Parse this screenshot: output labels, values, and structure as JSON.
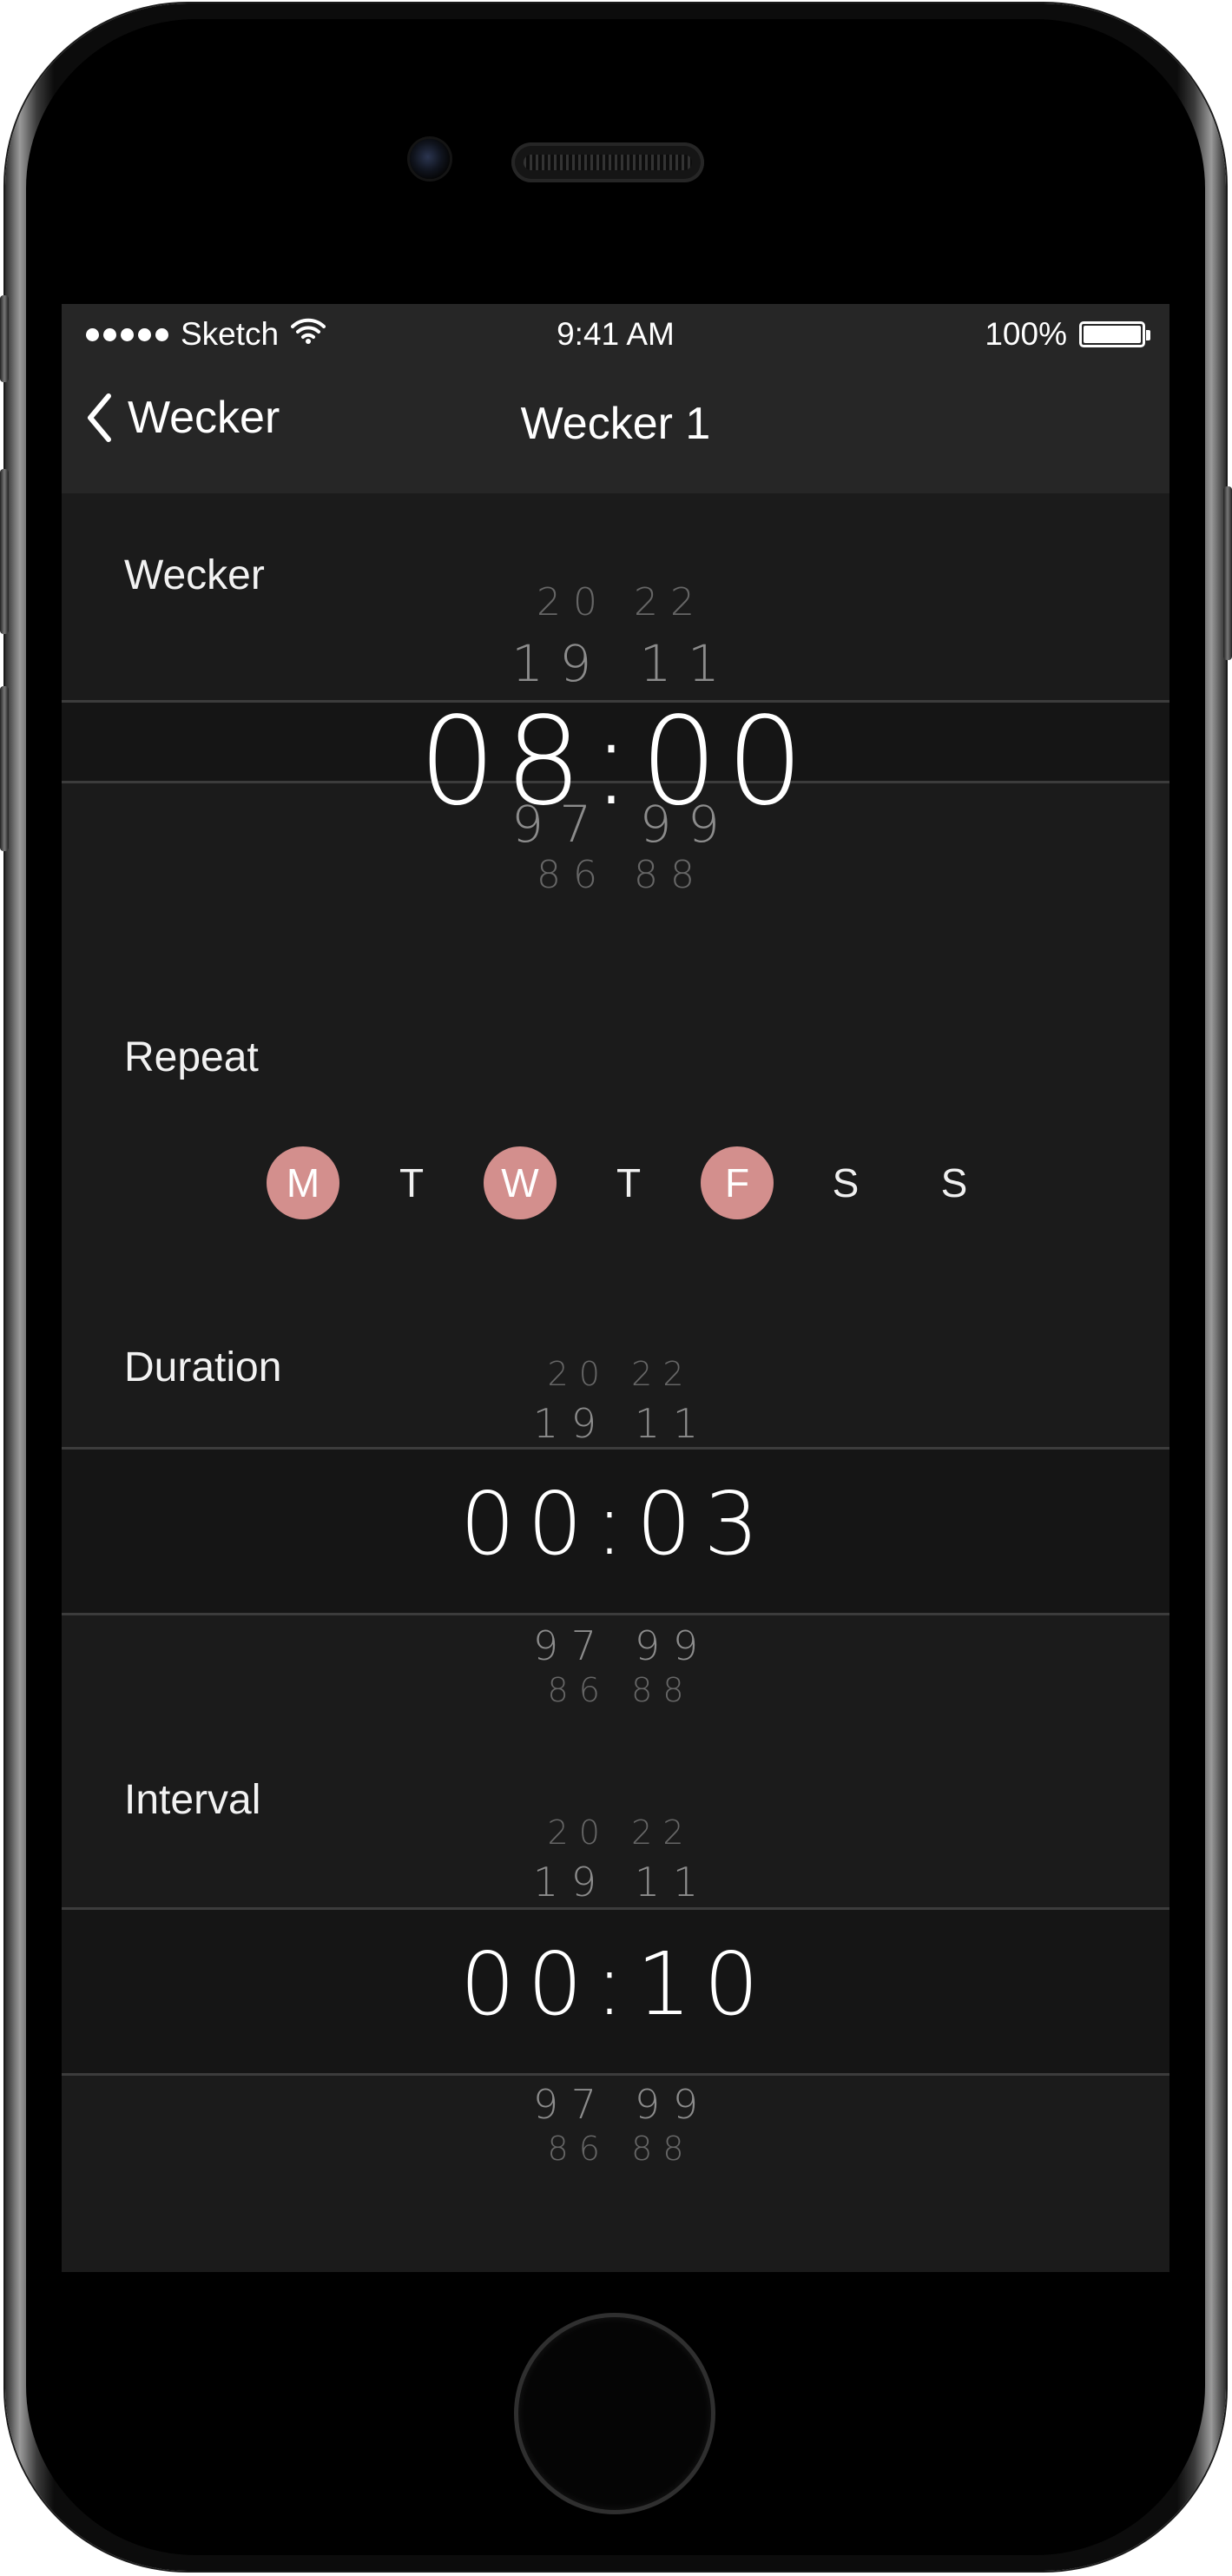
{
  "status_bar": {
    "carrier": "Sketch",
    "time": "9:41 AM",
    "battery": "100%"
  },
  "nav": {
    "back_label": "Wecker",
    "title": "Wecker 1"
  },
  "alarm": {
    "label": "Wecker",
    "above_far": "2 0   2 2",
    "above_near": "1 9   1 1",
    "value": "08:00",
    "below_near": "9 7   9 9",
    "below_far": "8 6   8 8"
  },
  "repeat": {
    "label": "Repeat",
    "days": [
      {
        "label": "M",
        "selected": true
      },
      {
        "label": "T",
        "selected": false
      },
      {
        "label": "W",
        "selected": true
      },
      {
        "label": "T",
        "selected": false
      },
      {
        "label": "F",
        "selected": true
      },
      {
        "label": "S",
        "selected": false
      },
      {
        "label": "S",
        "selected": false
      }
    ],
    "accent_color": "#d38f8d"
  },
  "duration": {
    "label": "Duration",
    "above_far": "2 0   2 2",
    "above_near": "1 9   1 1",
    "value": "00:03",
    "below_near": "9 7   9 9",
    "below_far": "8 6   8 8"
  },
  "interval": {
    "label": "Interval",
    "above_far": "2 0   2 2",
    "above_near": "1 9   1 1",
    "value": "00:10",
    "below_near": "9 7   9 9",
    "below_far": "8 6   8 8"
  }
}
